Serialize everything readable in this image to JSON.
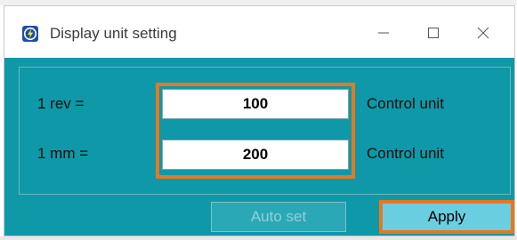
{
  "window": {
    "title": "Display unit setting",
    "icon": "app-logo-icon",
    "controls": {
      "minimize": "minimize-icon",
      "maximize": "maximize-icon",
      "close": "close-icon"
    }
  },
  "rows": [
    {
      "label": "1  rev  =",
      "value": "100",
      "unit": "Control unit"
    },
    {
      "label": "1  mm  =",
      "value": "200",
      "unit": "Control unit"
    }
  ],
  "buttons": {
    "auto_set": "Auto set",
    "apply": "Apply"
  },
  "colors": {
    "client_bg": "#0f98a8",
    "highlight": "#e8781f",
    "apply_bg": "#69cfe0"
  }
}
